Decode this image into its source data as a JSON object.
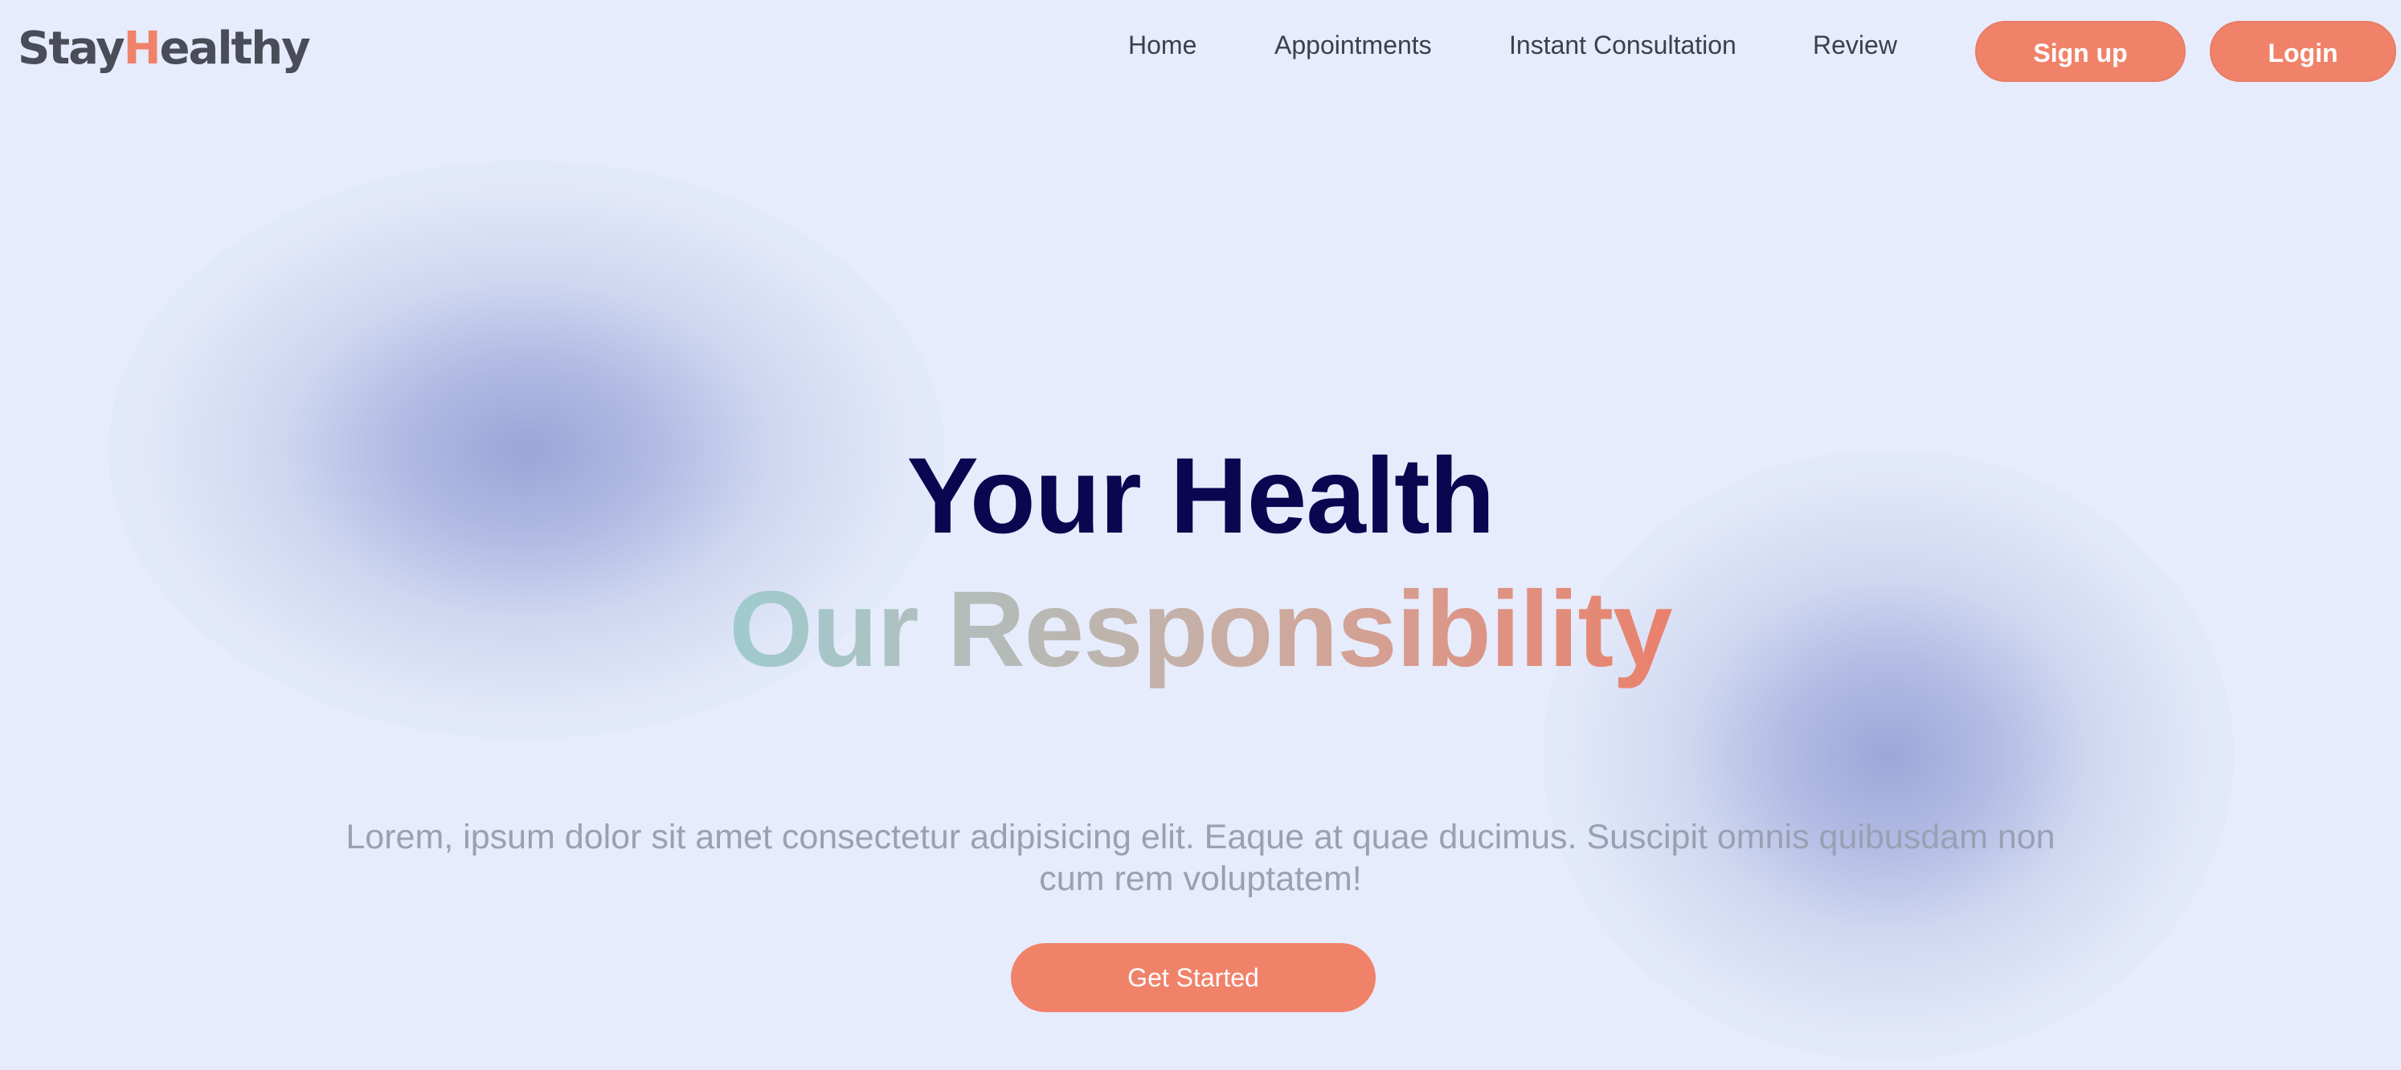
{
  "brand": {
    "logo_prefix": "Stay",
    "logo_accent": "H",
    "logo_suffix": "ealthy",
    "accent_color": "#f0826a"
  },
  "nav": {
    "links": [
      {
        "label": "Home"
      },
      {
        "label": "Appointments"
      },
      {
        "label": "Instant Consultation"
      },
      {
        "label": "Review"
      }
    ],
    "signup_label": "Sign up",
    "login_label": "Login"
  },
  "hero": {
    "title": "Your Health",
    "subtitle": "Our Responsibility",
    "title_color": "#0a0650",
    "subtitle_gradient": [
      "#9fcbcf",
      "#ea806c"
    ],
    "description": "Lorem, ipsum dolor sit amet consectetur adipisicing elit. Eaque at quae ducimus. Suscipit omnis quibusdam non cum rem voluptatem!",
    "cta_label": "Get Started"
  }
}
